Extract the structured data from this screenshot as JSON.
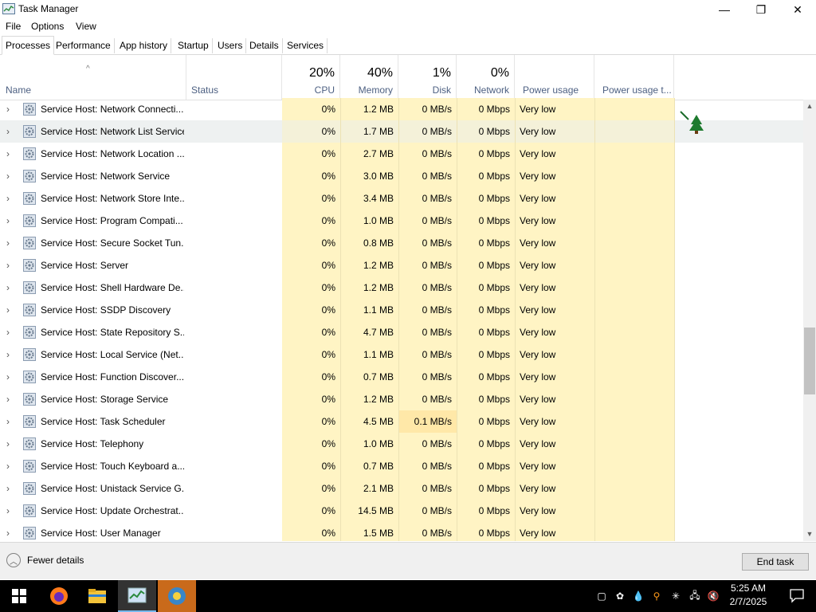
{
  "window": {
    "title": "Task Manager",
    "minimize_glyph": "—",
    "maximize_glyph": "❐",
    "close_glyph": "✕"
  },
  "menu": [
    "File",
    "Options",
    "View"
  ],
  "tabs": [
    {
      "label": "Processes",
      "active": true
    },
    {
      "label": "Performance"
    },
    {
      "label": "App history"
    },
    {
      "label": "Startup"
    },
    {
      "label": "Users"
    },
    {
      "label": "Details"
    },
    {
      "label": "Services"
    }
  ],
  "columns": {
    "name": {
      "label": "Name"
    },
    "status": {
      "label": "Status"
    },
    "cpu": {
      "label": "CPU",
      "pct": "20%"
    },
    "memory": {
      "label": "Memory",
      "pct": "40%"
    },
    "disk": {
      "label": "Disk",
      "pct": "1%"
    },
    "network": {
      "label": "Network",
      "pct": "0%"
    },
    "power": {
      "label": "Power usage"
    },
    "power_trend": {
      "label": "Power usage t..."
    }
  },
  "rows": [
    {
      "name": "Service Host: Network Connecti...",
      "cpu": "0%",
      "mem": "1.2 MB",
      "disk": "0 MB/s",
      "net": "0 Mbps",
      "power": "Very low"
    },
    {
      "name": "Service Host: Network List Service",
      "cpu": "0%",
      "mem": "1.7 MB",
      "disk": "0 MB/s",
      "net": "0 Mbps",
      "power": "Very low",
      "highlighted": true
    },
    {
      "name": "Service Host: Network Location ...",
      "cpu": "0%",
      "mem": "2.7 MB",
      "disk": "0 MB/s",
      "net": "0 Mbps",
      "power": "Very low"
    },
    {
      "name": "Service Host: Network Service",
      "cpu": "0%",
      "mem": "3.0 MB",
      "disk": "0 MB/s",
      "net": "0 Mbps",
      "power": "Very low"
    },
    {
      "name": "Service Host: Network Store Inte...",
      "cpu": "0%",
      "mem": "3.4 MB",
      "disk": "0 MB/s",
      "net": "0 Mbps",
      "power": "Very low"
    },
    {
      "name": "Service Host: Program Compati...",
      "cpu": "0%",
      "mem": "1.0 MB",
      "disk": "0 MB/s",
      "net": "0 Mbps",
      "power": "Very low"
    },
    {
      "name": "Service Host: Secure Socket Tun...",
      "cpu": "0%",
      "mem": "0.8 MB",
      "disk": "0 MB/s",
      "net": "0 Mbps",
      "power": "Very low"
    },
    {
      "name": "Service Host: Server",
      "cpu": "0%",
      "mem": "1.2 MB",
      "disk": "0 MB/s",
      "net": "0 Mbps",
      "power": "Very low"
    },
    {
      "name": "Service Host: Shell Hardware De...",
      "cpu": "0%",
      "mem": "1.2 MB",
      "disk": "0 MB/s",
      "net": "0 Mbps",
      "power": "Very low"
    },
    {
      "name": "Service Host: SSDP Discovery",
      "cpu": "0%",
      "mem": "1.1 MB",
      "disk": "0 MB/s",
      "net": "0 Mbps",
      "power": "Very low"
    },
    {
      "name": "Service Host: State Repository S...",
      "cpu": "0%",
      "mem": "4.7 MB",
      "disk": "0 MB/s",
      "net": "0 Mbps",
      "power": "Very low"
    },
    {
      "name": "Service Host: Local Service (Net...",
      "cpu": "0%",
      "mem": "1.1 MB",
      "disk": "0 MB/s",
      "net": "0 Mbps",
      "power": "Very low"
    },
    {
      "name": "Service Host: Function Discover...",
      "cpu": "0%",
      "mem": "0.7 MB",
      "disk": "0 MB/s",
      "net": "0 Mbps",
      "power": "Very low"
    },
    {
      "name": "Service Host: Storage Service",
      "cpu": "0%",
      "mem": "1.2 MB",
      "disk": "0 MB/s",
      "net": "0 Mbps",
      "power": "Very low"
    },
    {
      "name": "Service Host: Task Scheduler",
      "cpu": "0%",
      "mem": "4.5 MB",
      "disk": "0.1 MB/s",
      "net": "0 Mbps",
      "power": "Very low",
      "disk_hot": true
    },
    {
      "name": "Service Host: Telephony",
      "cpu": "0%",
      "mem": "1.0 MB",
      "disk": "0 MB/s",
      "net": "0 Mbps",
      "power": "Very low"
    },
    {
      "name": "Service Host: Touch Keyboard a...",
      "cpu": "0%",
      "mem": "0.7 MB",
      "disk": "0 MB/s",
      "net": "0 Mbps",
      "power": "Very low"
    },
    {
      "name": "Service Host: Unistack Service G...",
      "cpu": "0%",
      "mem": "2.1 MB",
      "disk": "0 MB/s",
      "net": "0 Mbps",
      "power": "Very low"
    },
    {
      "name": "Service Host: Update Orchestrat...",
      "cpu": "0%",
      "mem": "14.5 MB",
      "disk": "0 MB/s",
      "net": "0 Mbps",
      "power": "Very low"
    },
    {
      "name": "Service Host: User Manager",
      "cpu": "0%",
      "mem": "1.5 MB",
      "disk": "0 MB/s",
      "net": "0 Mbps",
      "power": "Very low"
    }
  ],
  "footer": {
    "fewer_details": "Fewer details",
    "end_task": "End task"
  },
  "taskbar": {
    "time": "5:25 AM",
    "date": "2/7/2025",
    "apps": [
      "start-icon",
      "firefox-icon",
      "file-explorer-icon",
      "task-manager-icon",
      "network-tool-icon"
    ]
  },
  "colors": {
    "column_heat": "#fff4c4",
    "column_heat_hot": "#ffe8a8",
    "header_label": "#4d6082",
    "row_highlight": "#eef1f1"
  }
}
